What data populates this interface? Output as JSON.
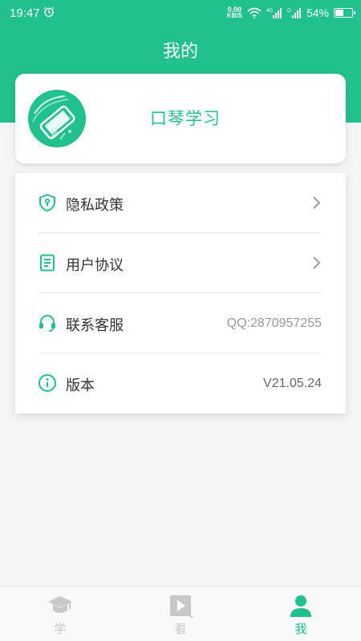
{
  "status_bar": {
    "time": "19:47",
    "net_speed_value": "0.00",
    "net_speed_unit": "KB/S",
    "battery": "54%",
    "battery_level": 0.54
  },
  "header": {
    "title": "我的"
  },
  "app_card": {
    "name": "口琴学习"
  },
  "menu": [
    {
      "label": "隐私政策",
      "icon": "shield-icon",
      "value": ""
    },
    {
      "label": "用户协议",
      "icon": "document-icon",
      "value": ""
    },
    {
      "label": "联系客服",
      "icon": "headset-icon",
      "value": "QQ:2870957255"
    },
    {
      "label": "版本",
      "icon": "info-icon",
      "value": "V21.05.24"
    }
  ],
  "tabs": [
    {
      "label": "学",
      "icon": "graduation-cap-icon",
      "active": false
    },
    {
      "label": "看",
      "icon": "video-icon",
      "active": false
    },
    {
      "label": "我",
      "icon": "person-icon",
      "active": true
    }
  ],
  "colors": {
    "accent": "#21c08f",
    "inactive": "#c8c8c8"
  }
}
